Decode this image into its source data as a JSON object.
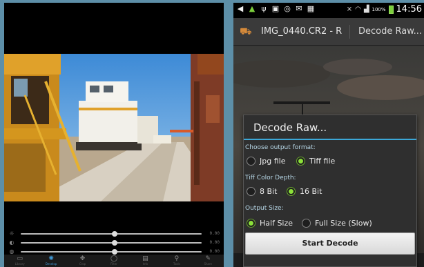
{
  "left_app": {
    "sliders": [
      {
        "icon": "sun-icon",
        "value_label": "0.00",
        "level": 0.52
      },
      {
        "icon": "contrast-icon",
        "value_label": "0.00",
        "level": 0.52
      },
      {
        "icon": "saturation-icon",
        "value_label": "0.00",
        "level": 0.52
      }
    ],
    "toolbar": [
      {
        "label": "Library",
        "icon": "library-icon",
        "active": false
      },
      {
        "label": "Develop",
        "icon": "develop-icon",
        "active": true
      },
      {
        "label": "Crop",
        "icon": "crop-icon",
        "active": false
      },
      {
        "label": "Filter",
        "icon": "filter-icon",
        "active": false
      },
      {
        "label": "Info",
        "icon": "info-icon",
        "active": false
      },
      {
        "label": "Tools",
        "icon": "tools-icon",
        "active": false
      },
      {
        "label": "Share",
        "icon": "share-icon",
        "active": false
      }
    ]
  },
  "right_app": {
    "status_bar": {
      "battery_percent": "100%",
      "time": "14:56"
    },
    "action_bar": {
      "file_title": "IMG_0440.CR2 - R",
      "action_label": "Decode Raw..."
    },
    "dialog": {
      "title": "Decode Raw...",
      "output_format": {
        "label": "Choose output format:",
        "options": [
          "Jpg file",
          "Tiff file"
        ],
        "selected": "Tiff file"
      },
      "tiff_depth": {
        "label": "Tiff Color Depth:",
        "options": [
          "8 Bit",
          "16 Bit"
        ],
        "selected": "16 Bit"
      },
      "output_size": {
        "label": "Output Size:",
        "options": [
          "Half Size",
          "Full Size (Slow)"
        ],
        "selected": "Half Size"
      },
      "start_button": "Start Decode"
    }
  },
  "colors": {
    "accent_blue": "#3ca8d8",
    "radio_green": "#8ce03a",
    "frame_blue": "#5d8fa8"
  }
}
